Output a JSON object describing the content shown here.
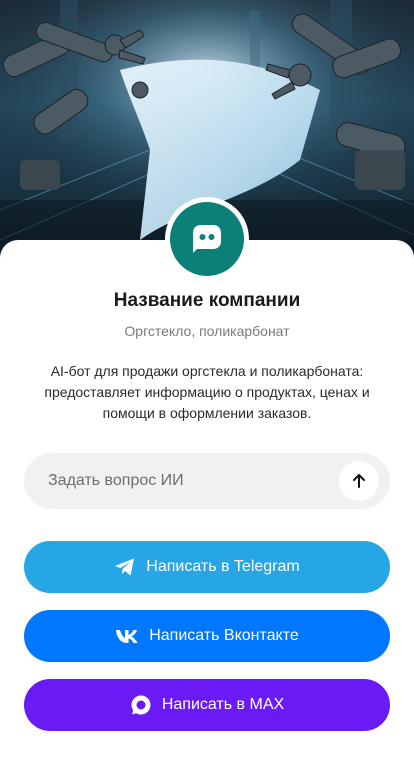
{
  "company": {
    "name": "Название компании",
    "category": "Оргстекло, поликарбонат",
    "description": "AI-бот для продажи оргстекла и поликарбоната: предоставляет информацию о продуктах, ценах и помощи в оформлении заказов."
  },
  "ask": {
    "placeholder": "Задать вопрос ИИ",
    "send_icon": "arrow-up-icon"
  },
  "buttons": {
    "telegram": {
      "label": "Написать в Telegram",
      "icon": "telegram-icon",
      "color": "#27a6e5"
    },
    "vk": {
      "label": "Написать Вконтакте",
      "icon": "vk-icon",
      "color": "#0077ff"
    },
    "max": {
      "label": "Написать в MAX",
      "icon": "max-icon",
      "color": "#6a1bf5"
    }
  },
  "colors": {
    "avatar_bg": "#0b7f78",
    "input_bg": "#f1f1f1"
  }
}
